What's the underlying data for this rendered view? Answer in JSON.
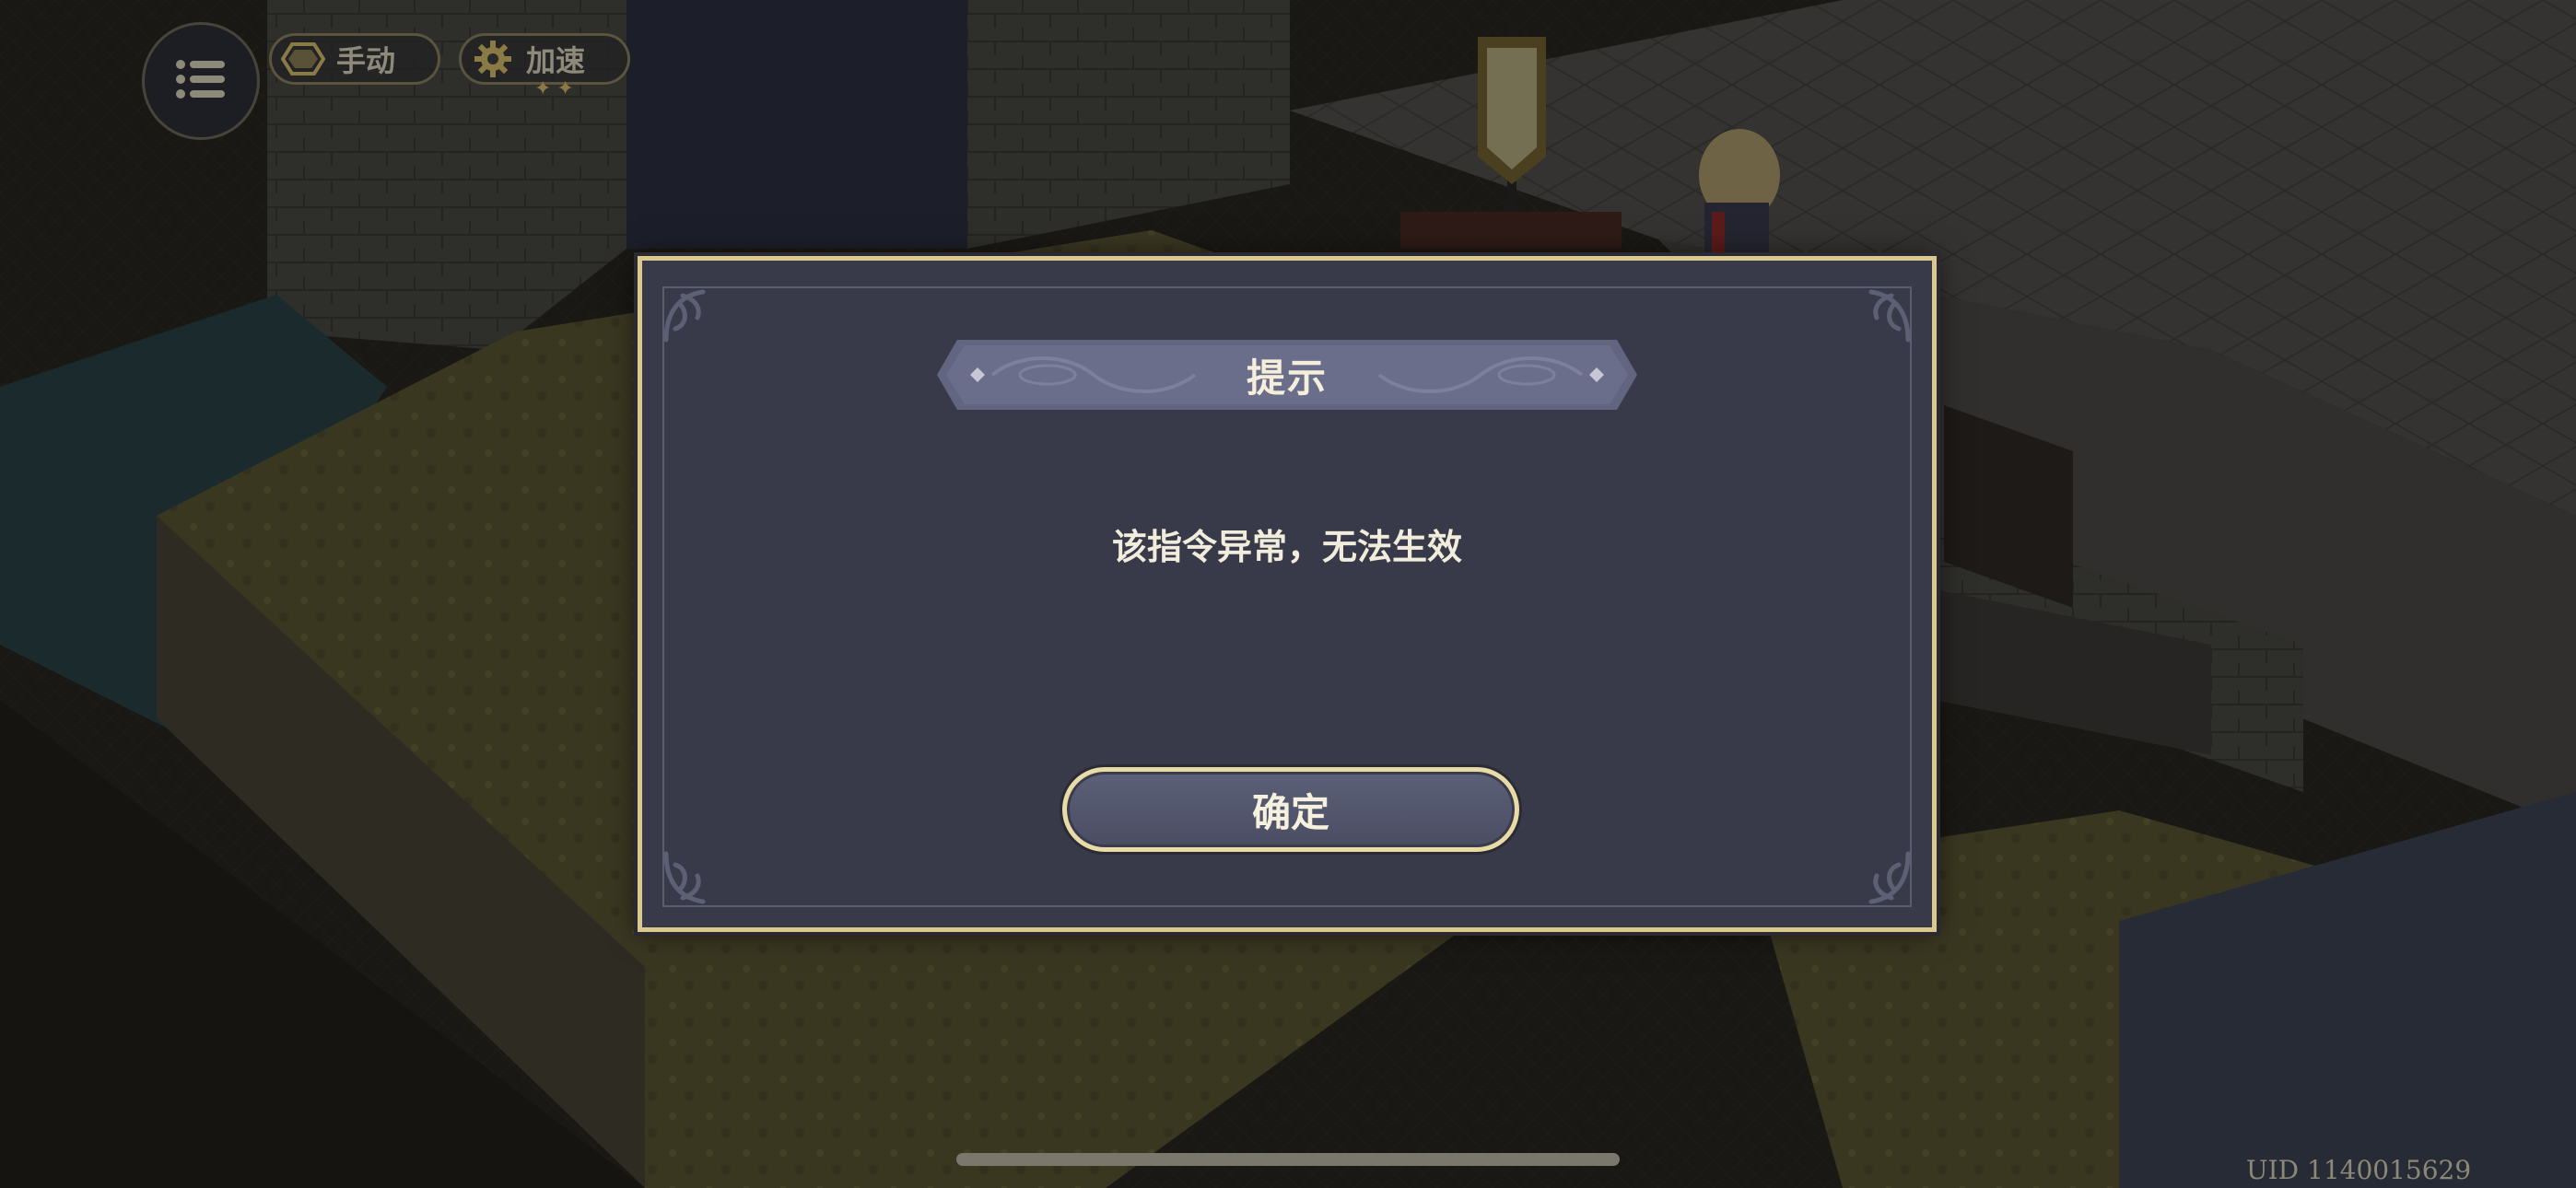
{
  "hud": {
    "menu_icon": "list-menu-icon",
    "manual_label": "手动",
    "manual_icon": "hexagon-icon",
    "speed_label": "加速",
    "speed_icon": "gear-icon",
    "speed_stars": "✦✦"
  },
  "dialog": {
    "title": "提示",
    "message": "该指令异常，无法生效",
    "confirm_label": "确定"
  },
  "footer": {
    "uid": "UID 1140015629"
  },
  "colors": {
    "dialog_bg": "#383a4a",
    "dialog_border": "#d9c98e",
    "text": "#f1ecdc",
    "button_bg": "#5c6078"
  }
}
